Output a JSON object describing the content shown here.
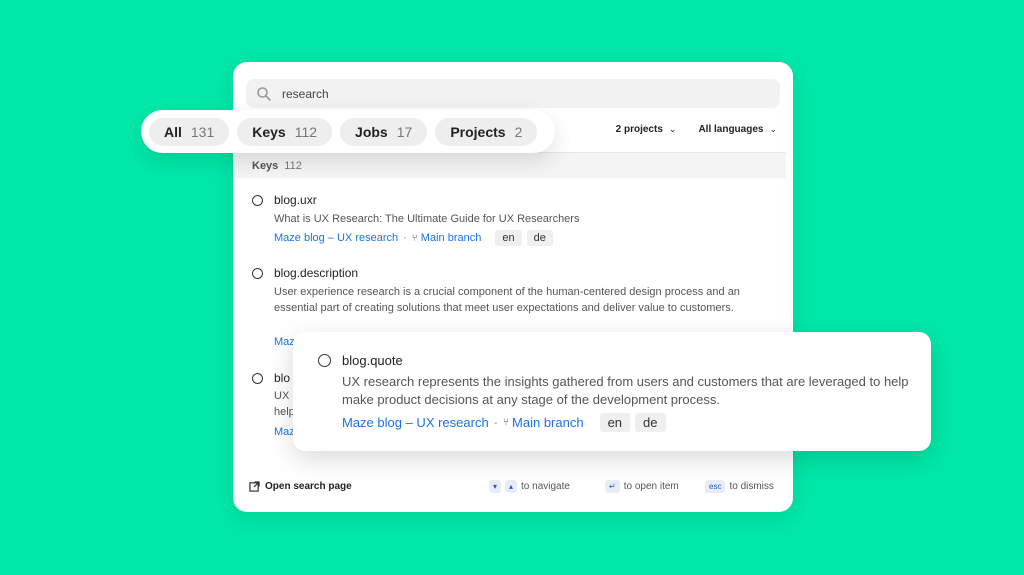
{
  "search": {
    "query": "research"
  },
  "tabs": [
    {
      "label": "All",
      "count": "131"
    },
    {
      "label": "Keys",
      "count": "112"
    },
    {
      "label": "Jobs",
      "count": "17"
    },
    {
      "label": "Projects",
      "count": "2"
    }
  ],
  "filters": {
    "projects": "2 projects",
    "languages": "All languages"
  },
  "section": {
    "title": "Keys",
    "count": "112"
  },
  "results": [
    {
      "key": "blog.uxr",
      "desc": "What is UX Research: The Ultimate Guide for UX Researchers",
      "project": "Maze blog – UX research",
      "branch": "Main branch",
      "langs": [
        "en",
        "de"
      ]
    },
    {
      "key": "blog.description",
      "desc": "User experience research is a crucial component of the human-centered design process and an essential part of creating solutions that meet user expectations and deliver value to customers.",
      "project": "Maze"
    },
    {
      "key": "blo",
      "desc1": "UX",
      "desc2": "help",
      "project": "Maz"
    }
  ],
  "popup": {
    "key": "blog.quote",
    "desc": "UX research represents the insights gathered from users and customers that are leveraged to help make product decisions at any stage of the development process.",
    "project": "Maze blog – UX research",
    "branch": "Main branch",
    "langs": [
      "en",
      "de"
    ]
  },
  "footer": {
    "open_search": "Open search page",
    "navigate": "to navigate",
    "open_item": "to open item",
    "esc_key": "esc",
    "dismiss": "to dismiss"
  }
}
